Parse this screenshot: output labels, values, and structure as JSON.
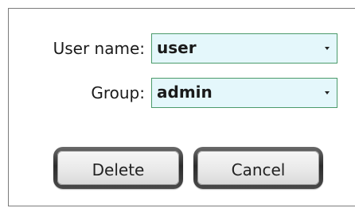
{
  "form": {
    "user_name": {
      "label": "User name:",
      "value": "user"
    },
    "group": {
      "label": "Group:",
      "value": "admin"
    }
  },
  "buttons": {
    "delete_label": "Delete",
    "cancel_label": "Cancel"
  },
  "colors": {
    "combo_background": "#e4f7fb",
    "combo_border": "#4b9a6a",
    "dialog_border": "#7b7b7b"
  },
  "icons": {
    "dropdown": "dropdown-arrow-icon"
  }
}
